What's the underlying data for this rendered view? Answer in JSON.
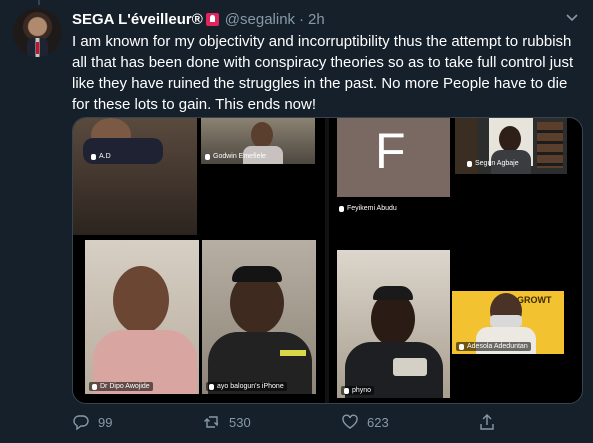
{
  "tweet": {
    "display_name": "SEGA L'éveilleur®",
    "handle": "@segalink",
    "separator": "·",
    "time": "2h",
    "text": "I am known for my objectivity and incorruptibility thus the attempt to rubbish all that has been done with conspiracy theories so as to take full control just like they have ruined the struggles in the past. No more People have to die for these lots to gain. This ends now!"
  },
  "media": {
    "left_grid": [
      {
        "label": "A.D"
      },
      {
        "label": "Godwin Emefiele"
      },
      {
        "label": "Dr Dipo Awojide"
      },
      {
        "label": "ayo balogun's iPhone"
      }
    ],
    "right_grid": [
      {
        "letter": "F",
        "label": "Feyikemi Abudu"
      },
      {
        "label": "Segun Agbaje"
      },
      {
        "label": "phyno"
      },
      {
        "label": "Adesola Adeduntan",
        "banner": "RE  GROWT"
      }
    ]
  },
  "actions": {
    "reply_count": "99",
    "retweet_count": "530",
    "like_count": "623"
  },
  "colors": {
    "background": "#15202b",
    "muted": "#8899a6",
    "accent_badge": "#e0245e"
  }
}
